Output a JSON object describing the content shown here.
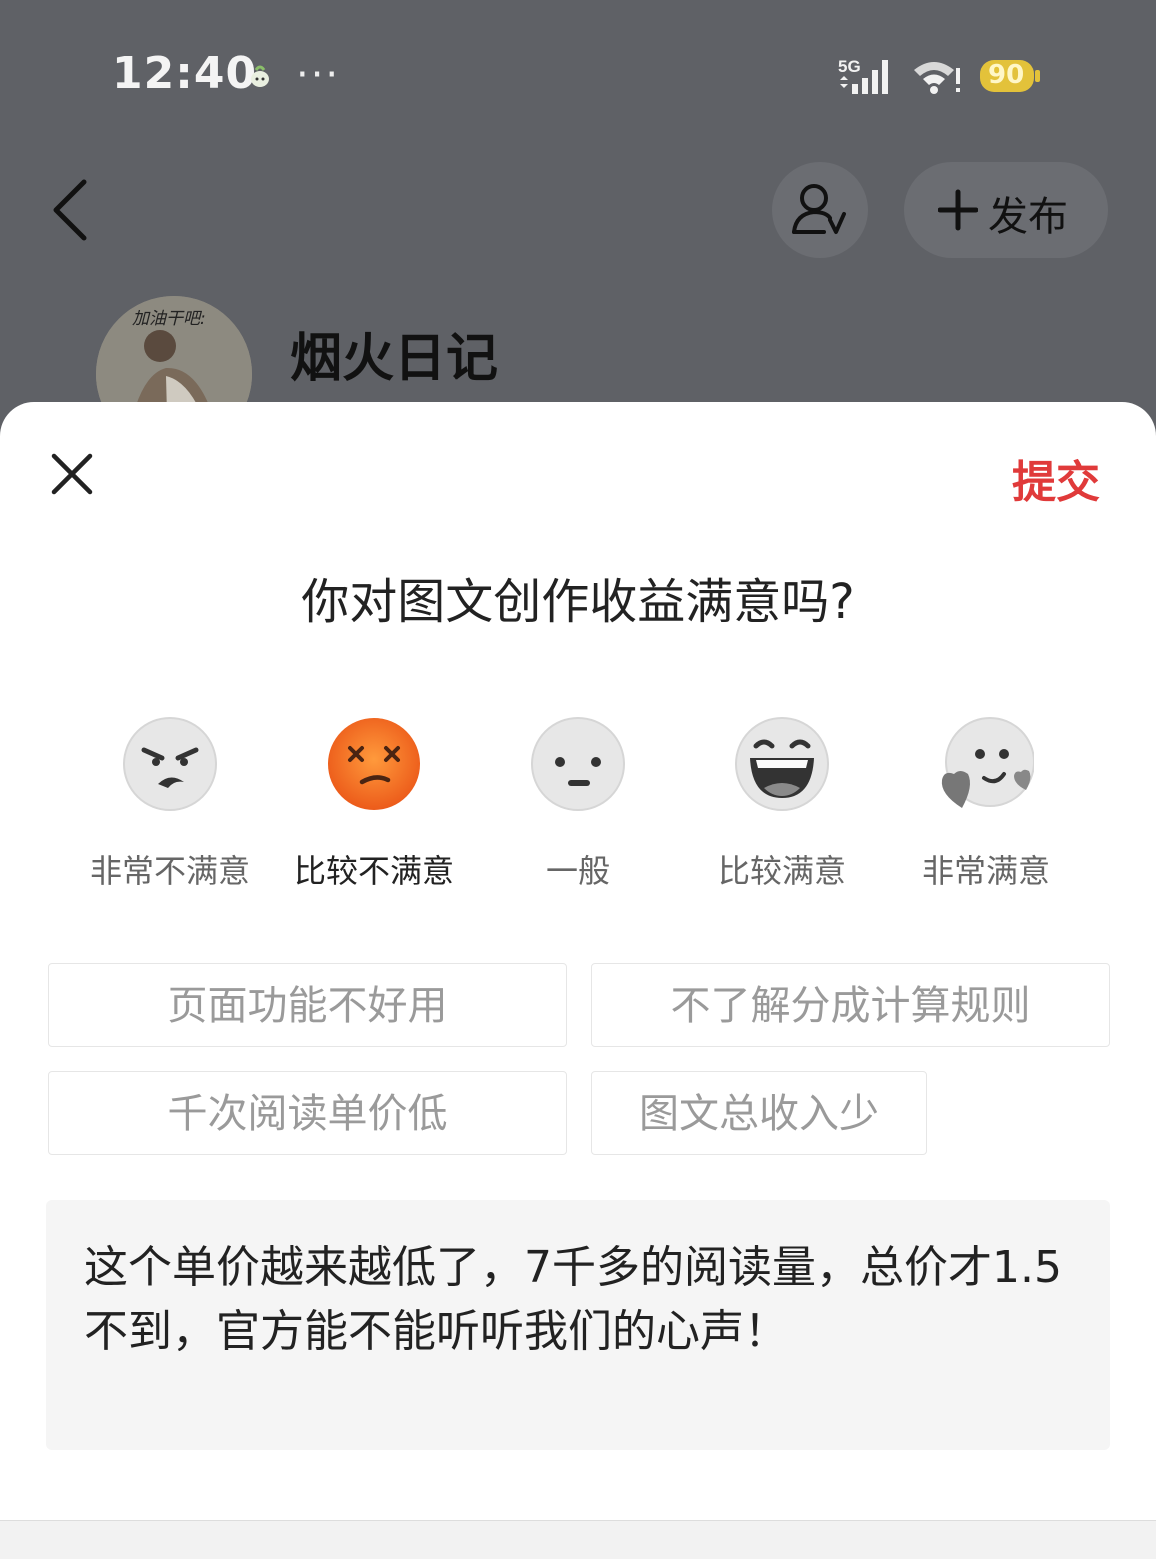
{
  "status_bar": {
    "time": "12:40",
    "dots": "···",
    "network": "5G",
    "battery": "90",
    "icons": [
      "sprite-icon",
      "signal-icon",
      "wifi-icon",
      "battery-icon"
    ]
  },
  "header": {
    "follow_icon": "user-follow-icon",
    "publish_label": "发布",
    "publish_icon": "plus-icon"
  },
  "profile": {
    "avatar_text": "加油干吧:",
    "name": "烟火日记"
  },
  "survey": {
    "submit_label": "提交",
    "question": "你对图文创作收益满意吗?",
    "ratings": [
      {
        "label": "非常不满意",
        "icon": "angry-face-icon",
        "selected": false
      },
      {
        "label": "比较不满意",
        "icon": "dizzy-face-icon",
        "selected": true
      },
      {
        "label": "一般",
        "icon": "neutral-face-icon",
        "selected": false
      },
      {
        "label": "比较满意",
        "icon": "laughing-face-icon",
        "selected": false
      },
      {
        "label": "非常满意",
        "icon": "hearts-face-icon",
        "selected": false
      }
    ],
    "reasons": [
      "页面功能不好用",
      "不了解分成计算规则",
      "千次阅读单价低",
      "图文总收入少"
    ],
    "comment": "这个单价越来越低了，7千多的阅读量，总价才1.5不到，官方能不能听听我们的心声！"
  },
  "colors": {
    "accent": "#e03a3a",
    "selected_face": "#f57a1f",
    "overlay": "#5f6166"
  }
}
